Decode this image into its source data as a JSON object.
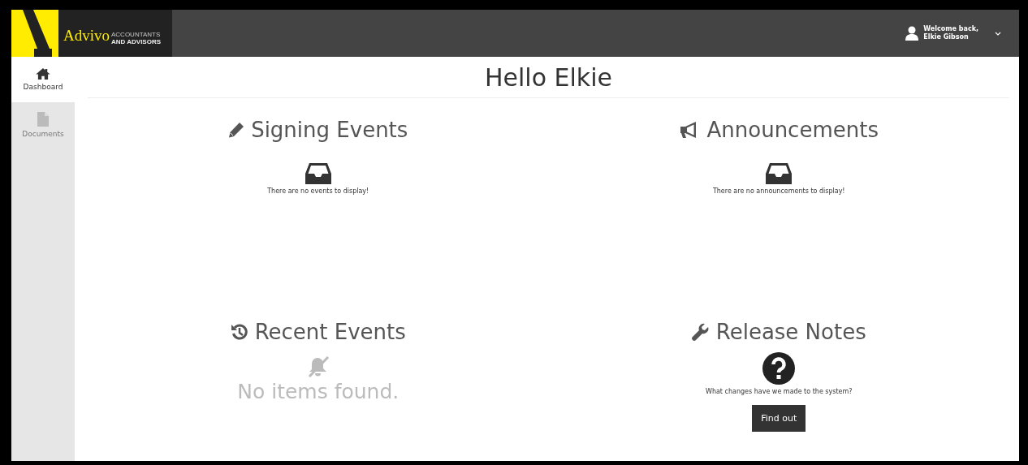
{
  "header": {
    "logo": {
      "name": "Advivo",
      "tagline_1": "ACCOUNTANTS",
      "tagline_2": "AND ADVISORS"
    },
    "user": {
      "greeting": "Welcome back,",
      "name": "Elkie Gibson"
    }
  },
  "sidebar": {
    "items": [
      {
        "label": "Dashboard",
        "selected": true
      },
      {
        "label": "Documents",
        "selected": false
      }
    ]
  },
  "title": "Hello Elkie",
  "panels": [
    {
      "kind": "empty",
      "title": "Signing Events",
      "message": "There are no events to display!"
    },
    {
      "kind": "empty",
      "title": "Announcements",
      "message": "There are no announcements to display!"
    },
    {
      "kind": "no_items",
      "title": "Recent Events",
      "message": "No items found."
    },
    {
      "kind": "release",
      "title": "Release Notes",
      "message": "What changes have we made to the system?",
      "button": "Find out"
    }
  ]
}
